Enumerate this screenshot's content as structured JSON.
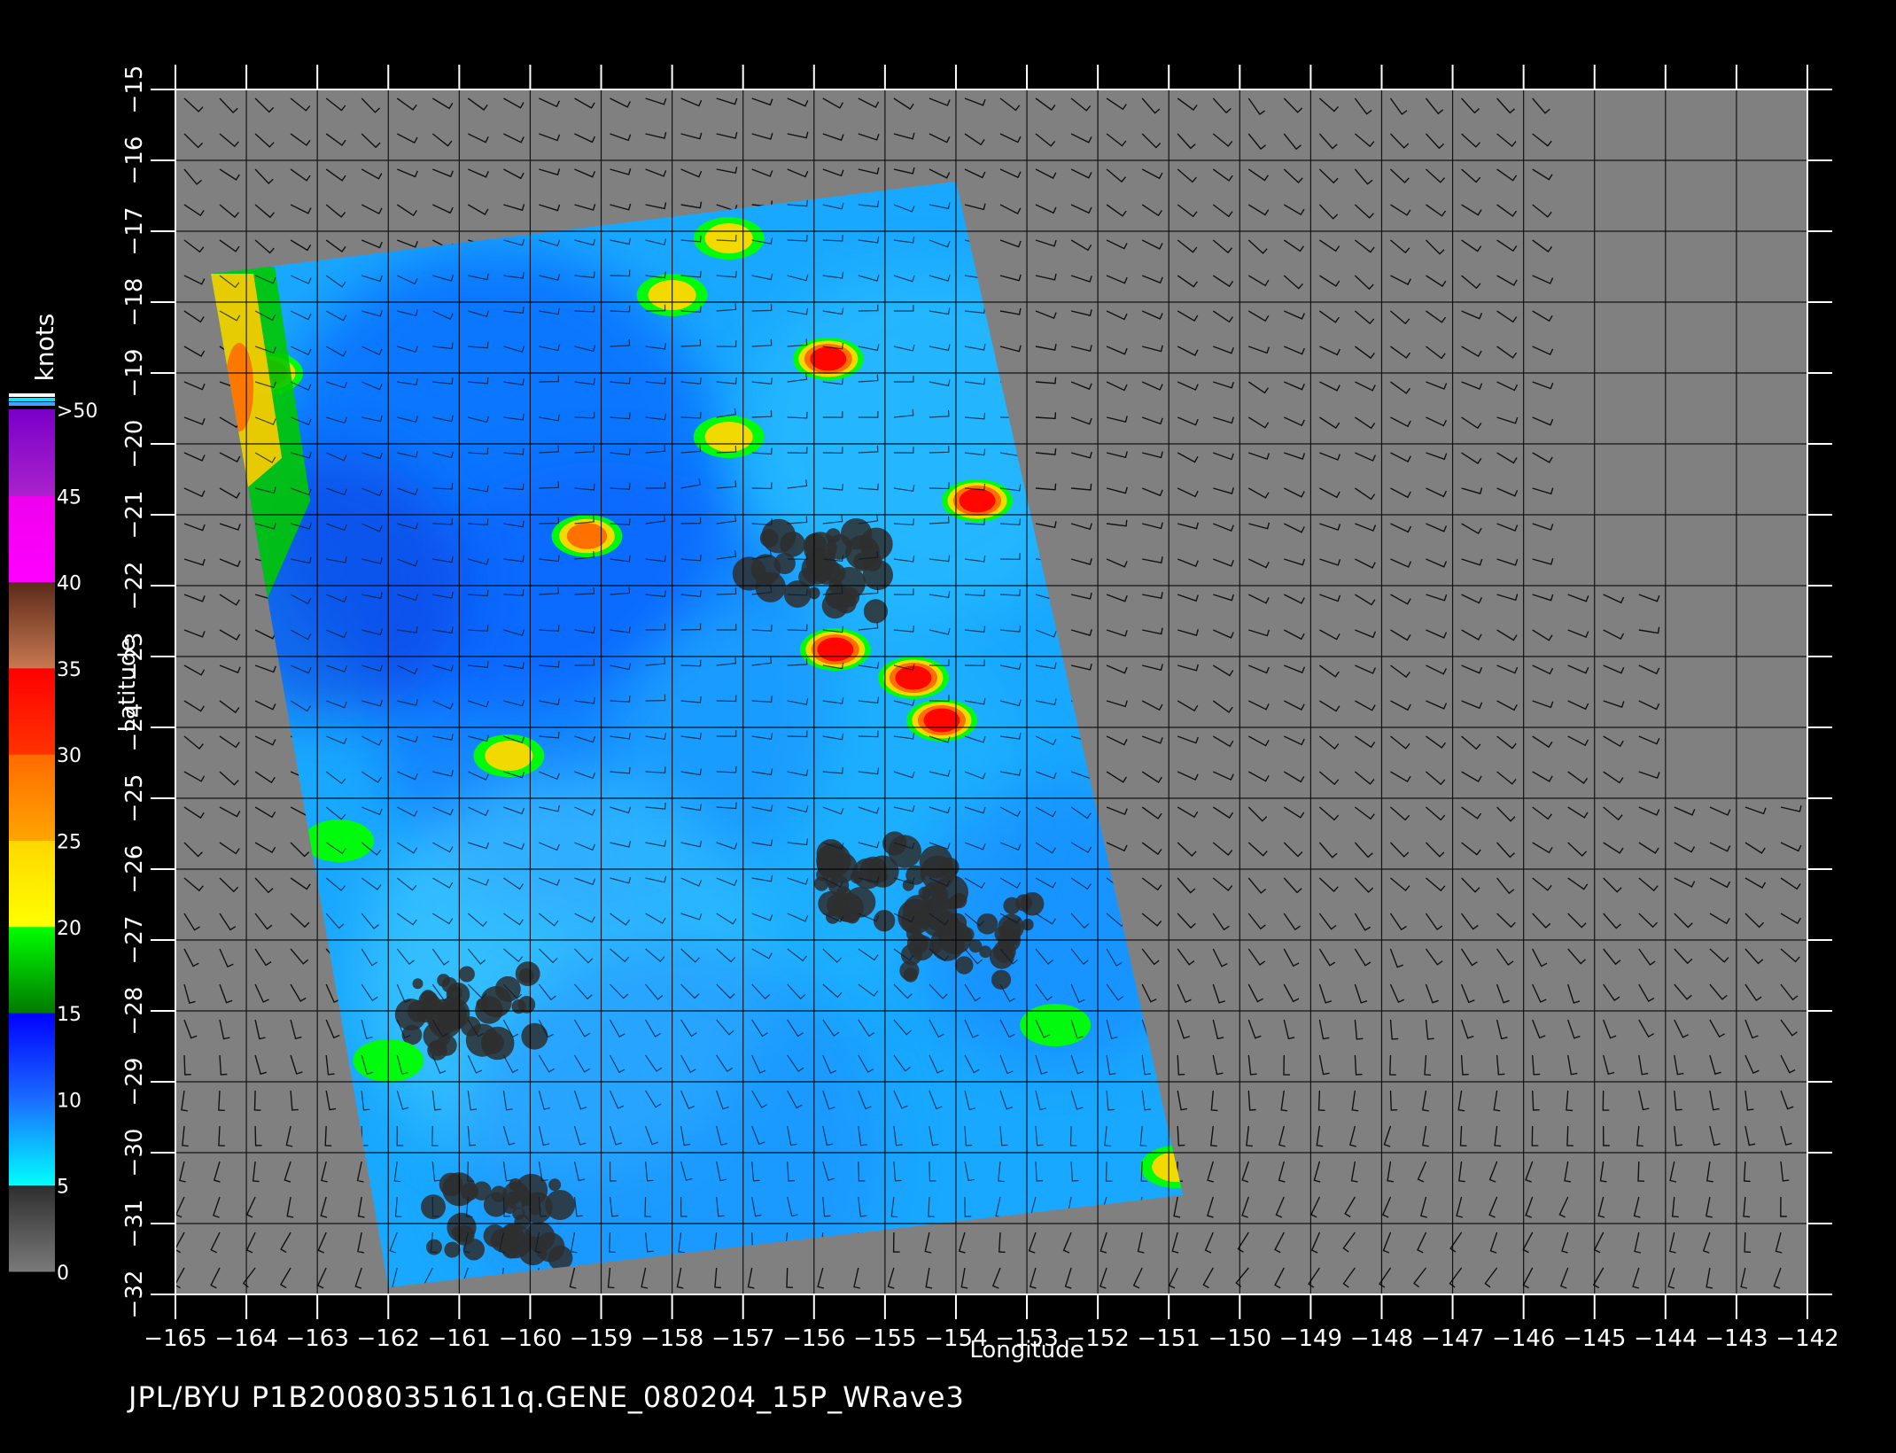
{
  "colorbar": {
    "unit_label": "knots",
    "tick_labels": [
      "0",
      "5",
      "10",
      "15",
      "20",
      "25",
      "30",
      "35",
      "40",
      "45",
      ">50"
    ],
    "bands": [
      {
        "from": 0,
        "to": 5,
        "color_top": "#2e2e2e",
        "color_bottom": "#7a7a7a"
      },
      {
        "from": 5,
        "to": 10,
        "color_top": "#1a6cff",
        "color_bottom": "#00ffff"
      },
      {
        "from": 10,
        "to": 15,
        "color_top": "#0000ff",
        "color_bottom": "#1a6cff"
      },
      {
        "from": 15,
        "to": 20,
        "color_top": "#00ff00",
        "color_bottom": "#007a00"
      },
      {
        "from": 20,
        "to": 25,
        "color_top": "#ffd700",
        "color_bottom": "#ffff00"
      },
      {
        "from": 25,
        "to": 30,
        "color_top": "#ff6a00",
        "color_bottom": "#ffa500"
      },
      {
        "from": 30,
        "to": 35,
        "color_top": "#ff0000",
        "color_bottom": "#ff3300"
      },
      {
        "from": 35,
        "to": 40,
        "color_top": "#5a2a1a",
        "color_bottom": "#c87850"
      },
      {
        "from": 40,
        "to": 45,
        "color_top": "#ee00ee",
        "color_bottom": "#ff00ff"
      },
      {
        "from": 45,
        "to": 50,
        "color_top": "#7a00c8",
        "color_bottom": "#aa22cc"
      }
    ],
    "overflow_colors": [
      "#ffffff",
      "#00e5ff",
      "#4aa0ff"
    ]
  },
  "axes": {
    "x_label": "Longitude",
    "y_label": "Latitude",
    "lon_range": [
      -165,
      -142
    ],
    "lat_range": [
      -32,
      -15
    ],
    "lon_ticks": [
      "-165",
      "-164",
      "-163",
      "-162",
      "-161",
      "-160",
      "-159",
      "-158",
      "-157",
      "-156",
      "-155",
      "-154",
      "-153",
      "-152",
      "-151",
      "-150",
      "-149",
      "-148",
      "-147",
      "-146",
      "-145",
      "-144",
      "-143",
      "-142"
    ],
    "lat_ticks": [
      "-32",
      "-31",
      "-30",
      "-29",
      "-28",
      "-27",
      "-26",
      "-25",
      "-24",
      "-23",
      "-22",
      "-21",
      "-20",
      "-19",
      "-18",
      "-17",
      "-16",
      "-15"
    ],
    "grid": true
  },
  "swath": {
    "corners_lonlat": [
      [
        -164.5,
        -17.6
      ],
      [
        -154.0,
        -16.3
      ],
      [
        -150.8,
        -30.6
      ],
      [
        -162.0,
        -31.9
      ]
    ],
    "base_color": "#19a8ff"
  },
  "high_wind_cells": [
    {
      "lon": -163.7,
      "lat": -19.0,
      "kt": 28
    },
    {
      "lon": -157.2,
      "lat": -17.1,
      "kt": 24
    },
    {
      "lon": -158.0,
      "lat": -17.9,
      "kt": 22
    },
    {
      "lon": -155.8,
      "lat": -18.8,
      "kt": 32
    },
    {
      "lon": -153.7,
      "lat": -20.8,
      "kt": 30
    },
    {
      "lon": -159.2,
      "lat": -21.3,
      "kt": 25
    },
    {
      "lon": -155.7,
      "lat": -22.9,
      "kt": 33
    },
    {
      "lon": -154.6,
      "lat": -23.3,
      "kt": 30
    },
    {
      "lon": -154.2,
      "lat": -23.9,
      "kt": 32
    },
    {
      "lon": -160.3,
      "lat": -24.4,
      "kt": 22
    },
    {
      "lon": -162.7,
      "lat": -25.6,
      "kt": 18
    },
    {
      "lon": -152.6,
      "lat": -28.2,
      "kt": 18
    },
    {
      "lon": -157.2,
      "lat": -19.9,
      "kt": 20
    },
    {
      "lon": -162.0,
      "lat": -28.7,
      "kt": 17
    },
    {
      "lon": -150.9,
      "lat": -30.2,
      "kt": 22
    }
  ],
  "low_wind_patches": [
    {
      "lon": -160.8,
      "lat": -28.0,
      "kt": 3
    },
    {
      "lon": -160.5,
      "lat": -31.0,
      "kt": 3
    },
    {
      "lon": -155.0,
      "lat": -26.2,
      "kt": 3
    },
    {
      "lon": -153.8,
      "lat": -27.0,
      "kt": 3
    },
    {
      "lon": -156.0,
      "lat": -21.8,
      "kt": 3
    }
  ],
  "footer_text": "JPL/BYU  P1B20080351611q.GENE_080204_15P_WRave3",
  "background_color": "#808080"
}
